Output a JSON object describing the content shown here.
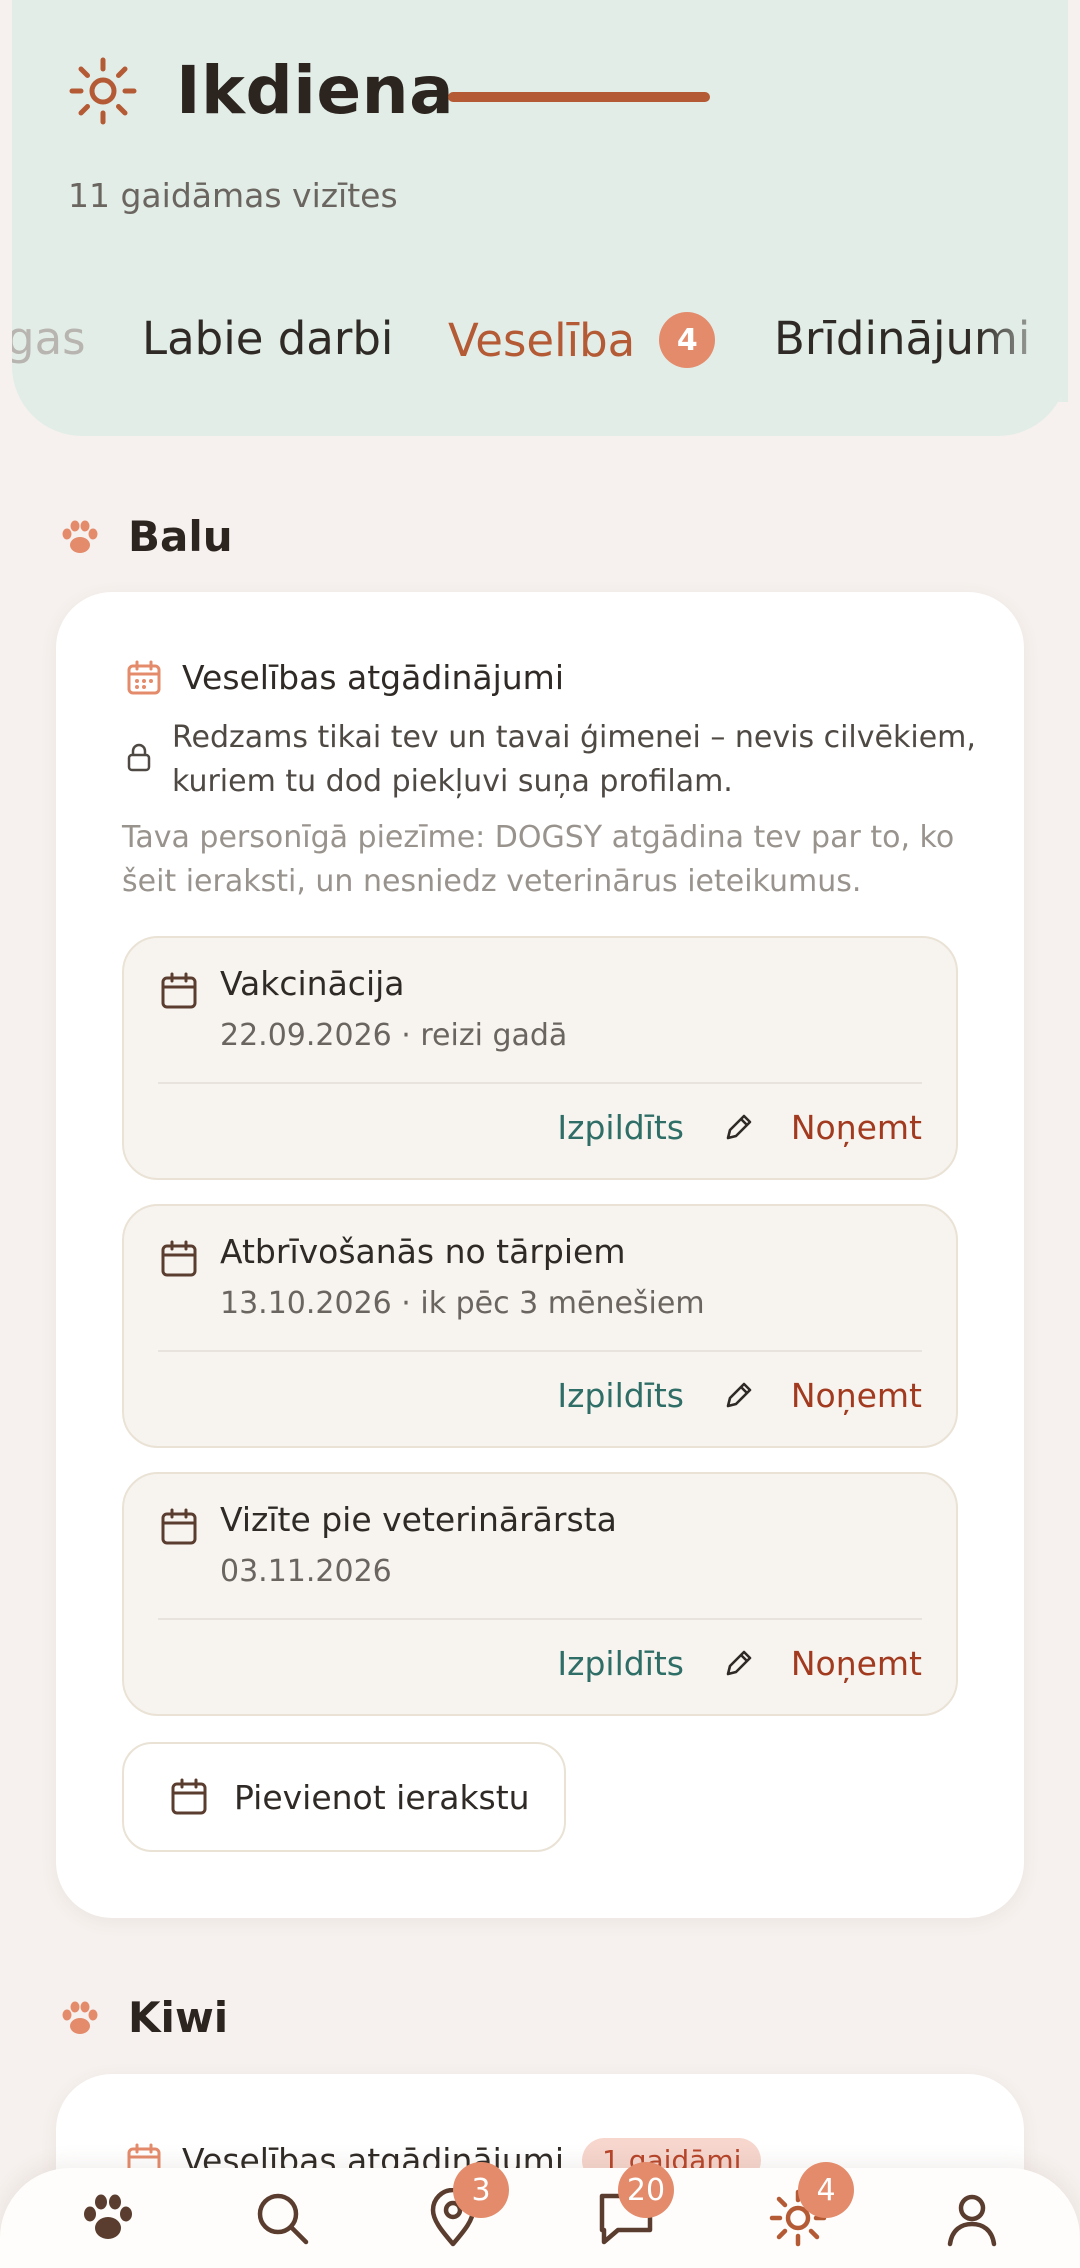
{
  "colors": {
    "accent": "#b45a34",
    "header_bg": "#e2ede8",
    "badge_bg": "#e48b6b",
    "done_text": "#2f6e66",
    "remove_text": "#a23a1f"
  },
  "header": {
    "icon": "sun-icon",
    "title": "Ikdiena",
    "subtitle": "11 gaidāmas vizītes"
  },
  "tabs": [
    {
      "label": "gas",
      "state": "partially-visible"
    },
    {
      "label": "Labie darbi"
    },
    {
      "label": "Veselība",
      "badge": "4",
      "active": true
    },
    {
      "label": "Brīdinājumi"
    }
  ],
  "pets": [
    {
      "name": "Balu",
      "icon": "paw-icon",
      "card": {
        "title": "Veselības atgādinājumi",
        "privacy": "Redzams tikai tev un tavai ģimenei – nevis cilvēkiem, kuriem tu dod piekļuvi suņa profilam.",
        "note": "Tava personīgā piezīme: DOGSY atgādina tev par to, ko šeit ieraksti, un nesniedz veterinārus ieteikumus.",
        "reminders": [
          {
            "title": "Vakcinācija",
            "subtitle": "22.09.2026 · reizi gadā",
            "done_label": "Izpildīts",
            "remove_label": "Noņemt"
          },
          {
            "title": "Atbrīvošanās no tārpiem",
            "subtitle": "13.10.2026 · ik pēc 3 mēnešiem",
            "done_label": "Izpildīts",
            "remove_label": "Noņemt"
          },
          {
            "title": "Vizīte pie veterinārārsta",
            "subtitle": "03.11.2026",
            "done_label": "Izpildīts",
            "remove_label": "Noņemt"
          }
        ],
        "add_label": "Pievienot ierakstu"
      }
    },
    {
      "name": "Kiwi",
      "icon": "paw-icon",
      "card": {
        "title": "Veselības atgādinājumi",
        "pending_badge": "1 gaidāmi"
      }
    }
  ],
  "bottom_nav": [
    {
      "icon": "paw-icon",
      "badge": null
    },
    {
      "icon": "search-icon",
      "badge": null
    },
    {
      "icon": "map-pin-icon",
      "badge": "3"
    },
    {
      "icon": "chat-icon",
      "badge": "20"
    },
    {
      "icon": "sun-icon",
      "badge": "4",
      "active": true
    },
    {
      "icon": "profile-icon",
      "badge": null
    }
  ]
}
